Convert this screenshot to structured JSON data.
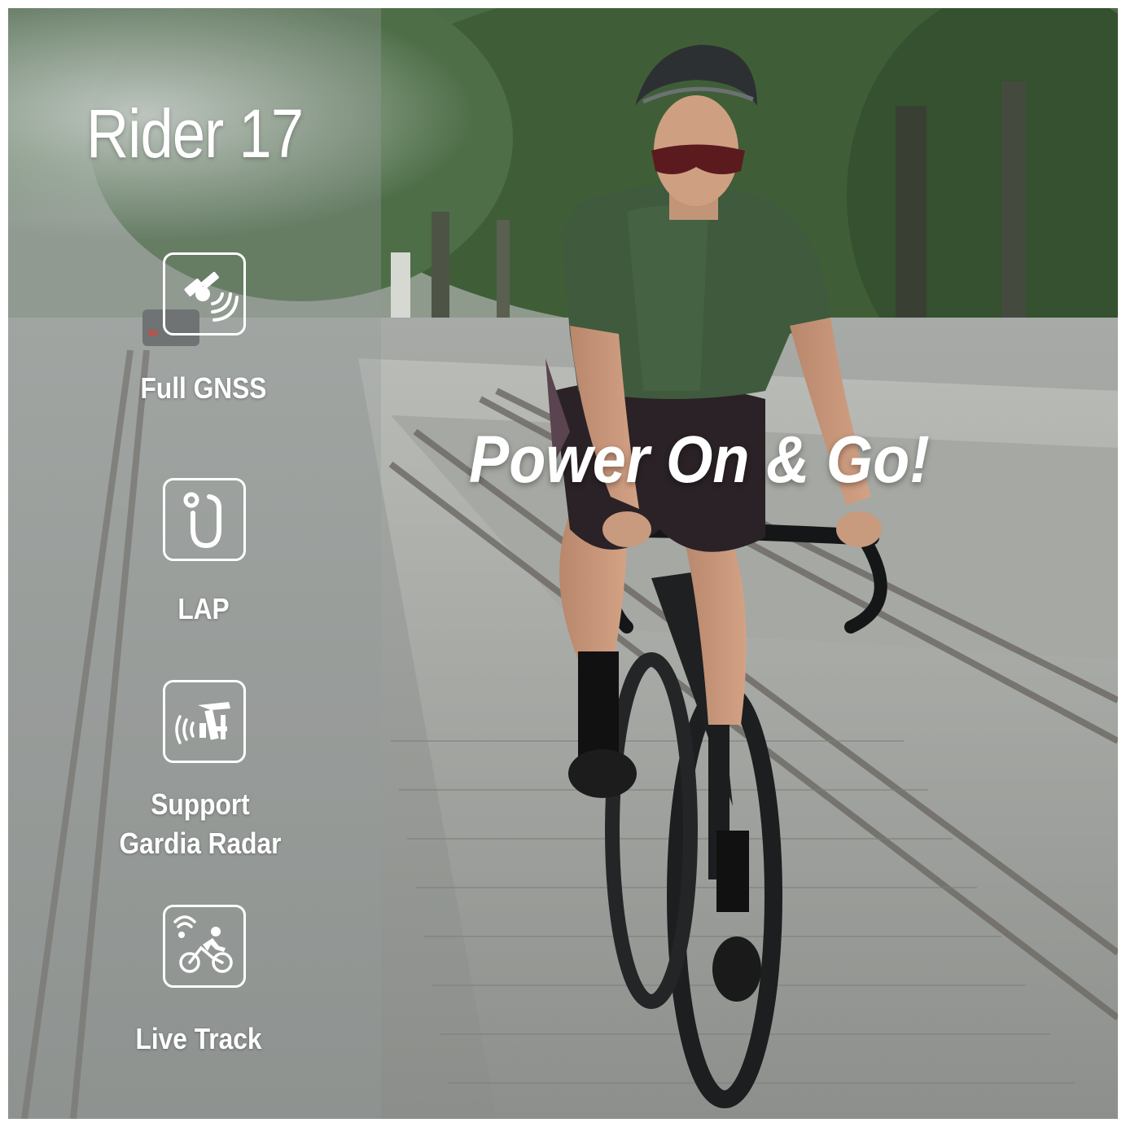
{
  "product": {
    "title": "Rider 17",
    "slogan": "Power On & Go!"
  },
  "features": [
    {
      "icon": "satellite-icon",
      "label": "Full GNSS"
    },
    {
      "icon": "lap-icon",
      "label": "LAP"
    },
    {
      "icon": "radar-icon",
      "label_line1": "Support",
      "label_line2": "Gardia Radar"
    },
    {
      "icon": "cyclist-signal-icon",
      "label": "Live Track"
    }
  ],
  "colors": {
    "text": "#ffffff",
    "panel_overlay": "#969c9b",
    "jersey": "#3f5a3c",
    "foliage": "#3d5a34"
  }
}
